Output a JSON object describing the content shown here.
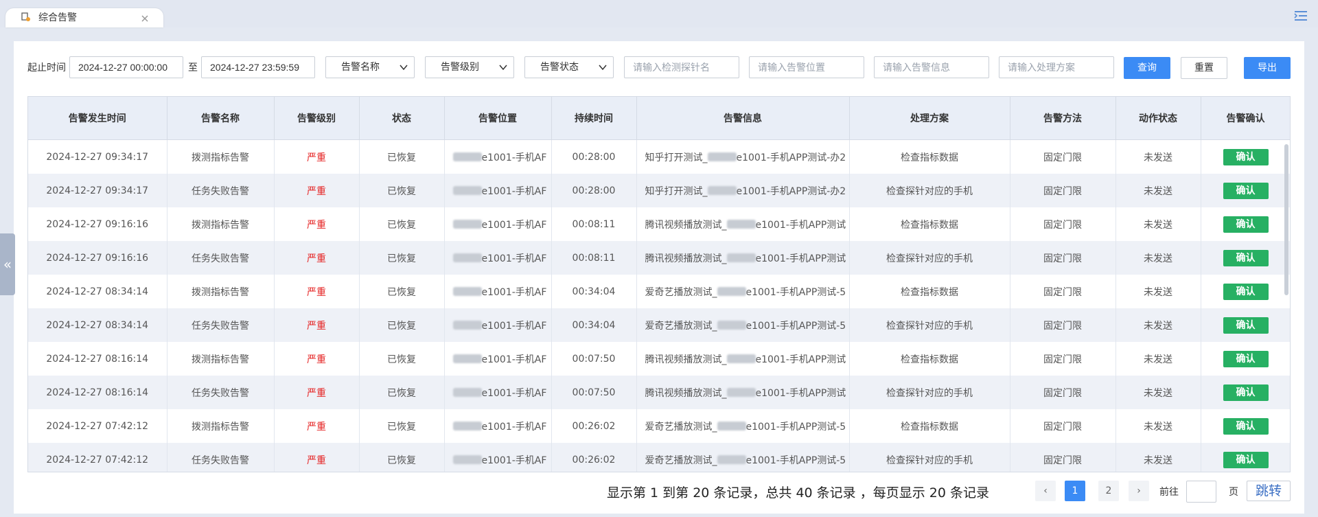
{
  "tab": {
    "label": "综合告警"
  },
  "filters": {
    "time_label": "起止时间",
    "start_time": "2024-12-27 00:00:00",
    "to_label": "至",
    "end_time": "2024-12-27 23:59:59",
    "select_name": "告警名称",
    "select_level": "告警级别",
    "select_status": "告警状态",
    "probe_placeholder": "请输入检测探针名",
    "location_placeholder": "请输入告警位置",
    "info_placeholder": "请输入告警信息",
    "solution_placeholder": "请输入处理方案",
    "query_label": "查询",
    "reset_label": "重置",
    "export_label": "导出"
  },
  "table": {
    "columns": [
      "告警发生时间",
      "告警名称",
      "告警级别",
      "状态",
      "告警位置",
      "持续时间",
      "告警信息",
      "处理方案",
      "告警方法",
      "动作状态",
      "告警确认"
    ],
    "confirm_label": "确认",
    "rows": [
      {
        "time": "2024-12-27 09:34:17",
        "name": "拨测指标告警",
        "level": "严重",
        "status": "已恢复",
        "location": "e1001-手机AF",
        "duration": "00:28:00",
        "info_prefix": "知乎打开测试_",
        "info_suffix": "e1001-手机APP测试-办2",
        "solution": "检查指标数据",
        "method": "固定门限",
        "action": "未发送"
      },
      {
        "time": "2024-12-27 09:34:17",
        "name": "任务失败告警",
        "level": "严重",
        "status": "已恢复",
        "location": "e1001-手机AF",
        "duration": "00:28:00",
        "info_prefix": "知乎打开测试_",
        "info_suffix": "e1001-手机APP测试-办2",
        "solution": "检查探针对应的手机",
        "method": "固定门限",
        "action": "未发送"
      },
      {
        "time": "2024-12-27 09:16:16",
        "name": "拨测指标告警",
        "level": "严重",
        "status": "已恢复",
        "location": "e1001-手机AF",
        "duration": "00:08:11",
        "info_prefix": "腾讯视频播放测试_",
        "info_suffix": "e1001-手机APP测试",
        "solution": "检查指标数据",
        "method": "固定门限",
        "action": "未发送"
      },
      {
        "time": "2024-12-27 09:16:16",
        "name": "任务失败告警",
        "level": "严重",
        "status": "已恢复",
        "location": "e1001-手机AF",
        "duration": "00:08:11",
        "info_prefix": "腾讯视频播放测试_",
        "info_suffix": "e1001-手机APP测试",
        "solution": "检查探针对应的手机",
        "method": "固定门限",
        "action": "未发送"
      },
      {
        "time": "2024-12-27 08:34:14",
        "name": "拨测指标告警",
        "level": "严重",
        "status": "已恢复",
        "location": "e1001-手机AF",
        "duration": "00:34:04",
        "info_prefix": "爱奇艺播放测试_",
        "info_suffix": "e1001-手机APP测试-5",
        "solution": "检查指标数据",
        "method": "固定门限",
        "action": "未发送"
      },
      {
        "time": "2024-12-27 08:34:14",
        "name": "任务失败告警",
        "level": "严重",
        "status": "已恢复",
        "location": "e1001-手机AF",
        "duration": "00:34:04",
        "info_prefix": "爱奇艺播放测试_",
        "info_suffix": "e1001-手机APP测试-5",
        "solution": "检查探针对应的手机",
        "method": "固定门限",
        "action": "未发送"
      },
      {
        "time": "2024-12-27 08:16:14",
        "name": "拨测指标告警",
        "level": "严重",
        "status": "已恢复",
        "location": "e1001-手机AF",
        "duration": "00:07:50",
        "info_prefix": "腾讯视频播放测试_",
        "info_suffix": "e1001-手机APP测试",
        "solution": "检查指标数据",
        "method": "固定门限",
        "action": "未发送"
      },
      {
        "time": "2024-12-27 08:16:14",
        "name": "任务失败告警",
        "level": "严重",
        "status": "已恢复",
        "location": "e1001-手机AF",
        "duration": "00:07:50",
        "info_prefix": "腾讯视频播放测试_",
        "info_suffix": "e1001-手机APP测试",
        "solution": "检查探针对应的手机",
        "method": "固定门限",
        "action": "未发送"
      },
      {
        "time": "2024-12-27 07:42:12",
        "name": "拨测指标告警",
        "level": "严重",
        "status": "已恢复",
        "location": "e1001-手机AF",
        "duration": "00:26:02",
        "info_prefix": "爱奇艺播放测试_",
        "info_suffix": "e1001-手机APP测试-5",
        "solution": "检查指标数据",
        "method": "固定门限",
        "action": "未发送"
      },
      {
        "time": "2024-12-27 07:42:12",
        "name": "任务失败告警",
        "level": "严重",
        "status": "已恢复",
        "location": "e1001-手机AF",
        "duration": "00:26:02",
        "info_prefix": "爱奇艺播放测试_",
        "info_suffix": "e1001-手机APP测试-5",
        "solution": "检查探针对应的手机",
        "method": "固定门限",
        "action": "未发送"
      }
    ]
  },
  "pagination": {
    "info": "显示第 1 到第 20 条记录，总共 40 条记录 ，每页显示 20 条记录",
    "prev": "‹",
    "pages": [
      "1",
      "2"
    ],
    "current_page": "1",
    "next": "›",
    "goto_label": "前往",
    "page_unit": "页",
    "jump_label": "跳转"
  },
  "colors": {
    "primary": "#3b8bf5",
    "severe": "#e52323",
    "confirm": "#27b063"
  }
}
